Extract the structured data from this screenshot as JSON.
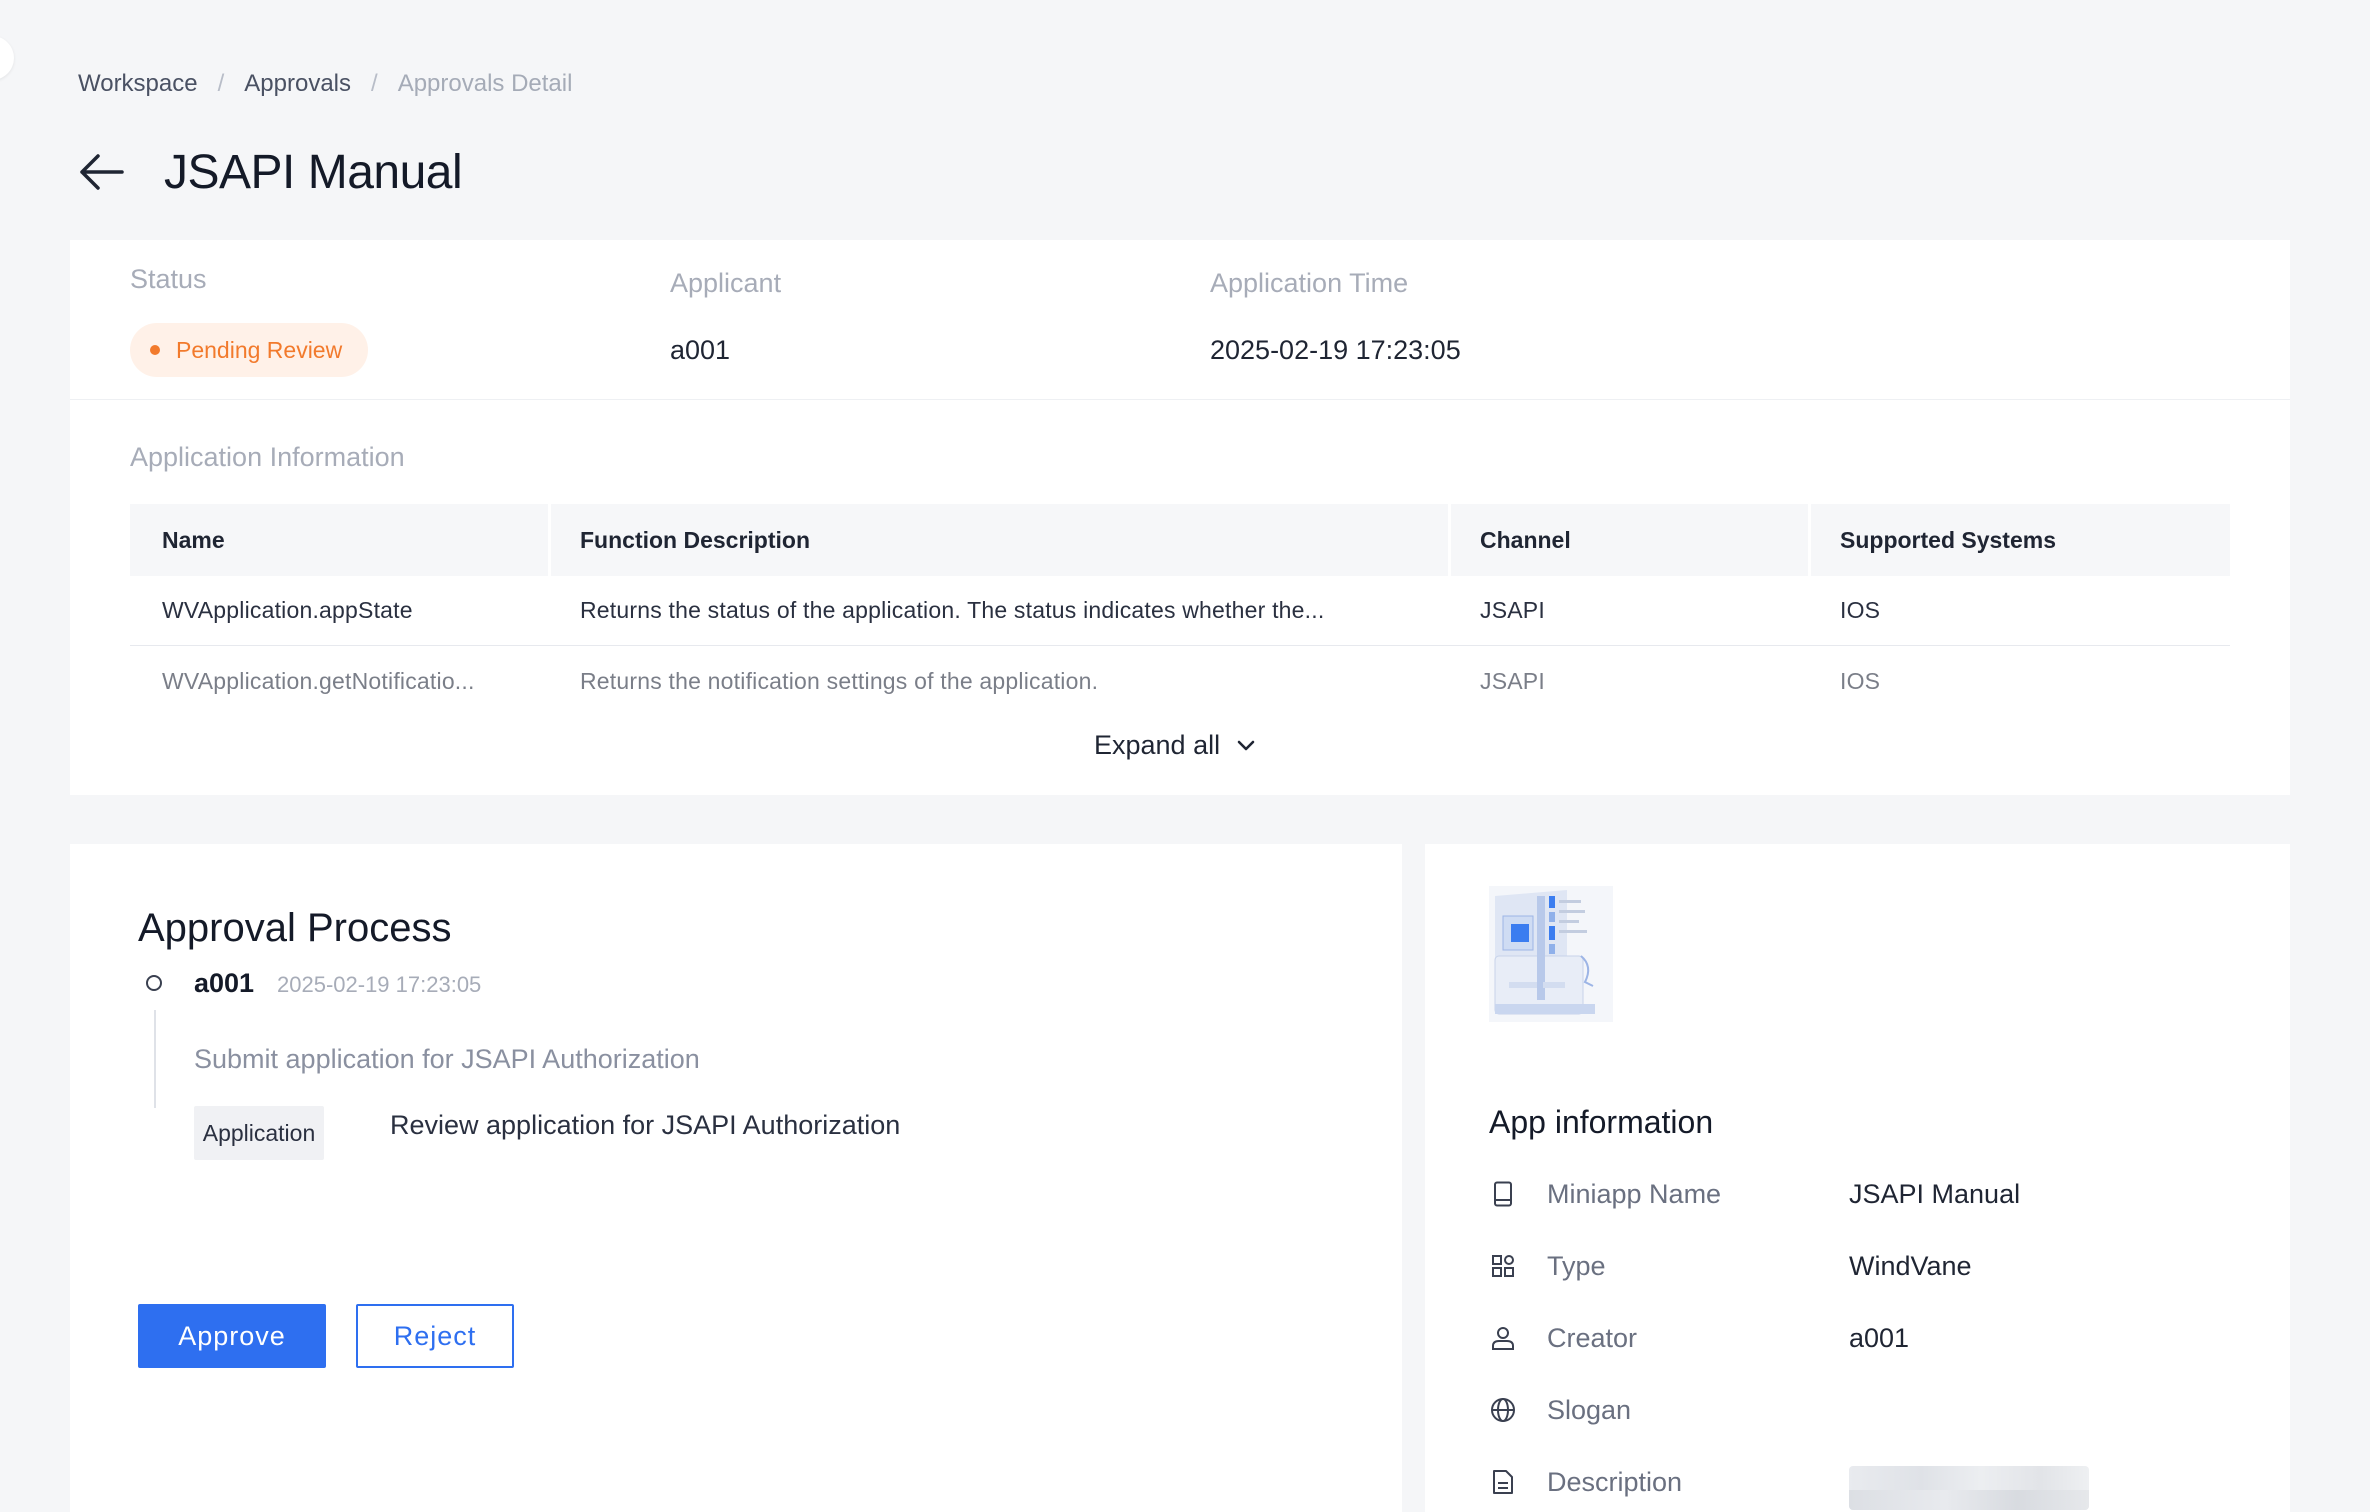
{
  "breadcrumb": {
    "items": [
      "Workspace",
      "Approvals"
    ],
    "current": "Approvals Detail",
    "separator": "/"
  },
  "header": {
    "back_icon": "arrow-left-icon",
    "title": "JSAPI Manual"
  },
  "summary": {
    "status_label": "Status",
    "status_value": "Pending Review",
    "status_color": "#f27a2c",
    "applicant_label": "Applicant",
    "applicant_value": "a001",
    "time_label": "Application Time",
    "time_value": "2025-02-19 17:23:05"
  },
  "application_info": {
    "label": "Application Information",
    "columns": [
      "Name",
      "Function Description",
      "Channel",
      "Supported Systems"
    ],
    "rows": [
      [
        "WVApplication.appState",
        "Returns the status of the application. The status indicates whether the...",
        "JSAPI",
        "IOS"
      ],
      [
        "WVApplication.getNotificatio...",
        "Returns the notification settings of the application.",
        "JSAPI",
        "IOS"
      ]
    ],
    "expand_label": "Expand all"
  },
  "approval_process": {
    "title": "Approval Process",
    "approver": "a001",
    "time": "2025-02-19 17:23:05",
    "submit_text": "Submit application for JSAPI Authorization",
    "tag": "Application",
    "review_text": "Review application for JSAPI Authorization",
    "approve_label": "Approve",
    "reject_label": "Reject",
    "accent_color": "#2e6ff0"
  },
  "app_info": {
    "title": "App information",
    "rows": [
      {
        "icon": "mobile-icon",
        "label": "Miniapp Name",
        "value": "JSAPI Manual"
      },
      {
        "icon": "grid-icon",
        "label": "Type",
        "value": "WindVane"
      },
      {
        "icon": "user-icon",
        "label": "Creator",
        "value": "a001"
      },
      {
        "icon": "globe-icon",
        "label": "Slogan",
        "value": ""
      },
      {
        "icon": "document-icon",
        "label": "Description",
        "value": ""
      }
    ]
  }
}
